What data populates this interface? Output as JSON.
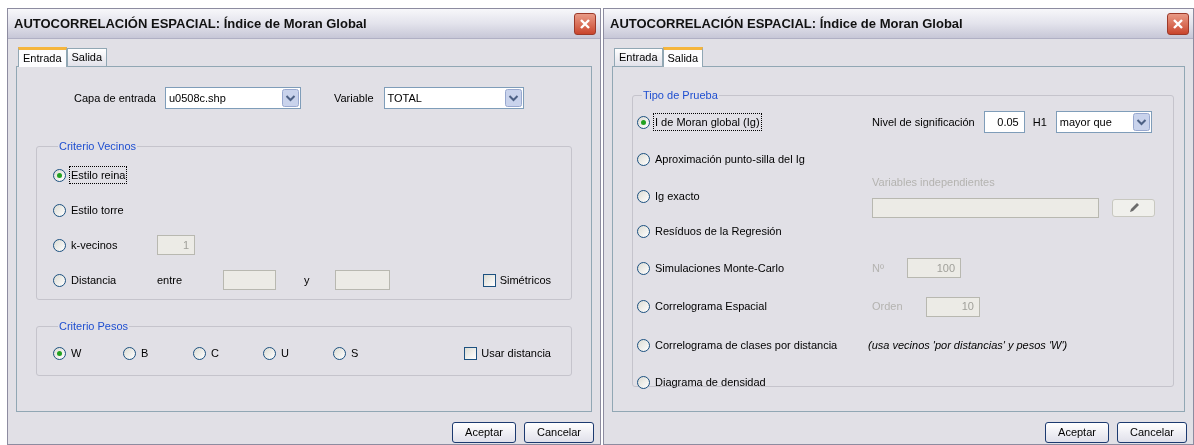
{
  "dialogs": [
    {
      "kind": "input",
      "title": "AUTOCORRELACIÓN ESPACIAL: Índice de Moran Global",
      "tabs": [
        {
          "label": "Entrada",
          "selected": true
        },
        {
          "label": "Salida",
          "selected": false
        }
      ],
      "fields": [
        {
          "label": "Capa de entrada",
          "value": "u0508c.shp"
        },
        {
          "label": "Variable",
          "value": "TOTAL"
        }
      ],
      "neighbors": {
        "title": "Criterio Vecinos",
        "options": [
          {
            "kind": "plain",
            "label": "Estilo reina",
            "selected": true,
            "focused": true
          },
          {
            "kind": "plain",
            "label": "Estilo torre",
            "selected": false,
            "focused": false
          },
          {
            "kind": "count",
            "label": "k-vecinos",
            "selected": false,
            "focused": false,
            "disabled": true,
            "value": "1"
          },
          {
            "kind": "range",
            "label": "Distancia",
            "selected": false,
            "focused": false,
            "disabled": true,
            "from_label": "entre",
            "to_label": "y",
            "checkbox": {
              "label": "Simétricos",
              "checked": false
            }
          }
        ]
      },
      "weights": {
        "title": "Criterio Pesos",
        "options": [
          {
            "label": "W",
            "selected": true
          },
          {
            "label": "B",
            "selected": false
          },
          {
            "label": "C",
            "selected": false
          },
          {
            "label": "U",
            "selected": false
          },
          {
            "label": "S",
            "selected": false
          }
        ],
        "checkbox": {
          "label": "Usar distancia",
          "checked": false
        }
      },
      "buttons": [
        "Aceptar",
        "Cancelar"
      ]
    },
    {
      "kind": "output",
      "title": "AUTOCORRELACIÓN ESPACIAL: Índice de Moran Global",
      "tabs": [
        {
          "label": "Entrada",
          "selected": false
        },
        {
          "label": "Salida",
          "selected": true
        }
      ],
      "test_type": {
        "title": "Tipo de Prueba",
        "options": [
          {
            "kind": "significance",
            "label": "I de Moran global (Ig)",
            "selected": true,
            "focused": true,
            "level_label": "Nivel de significación",
            "level_value": "0.05",
            "h1_label": "H1",
            "h1_value": "mayor que"
          },
          {
            "kind": "plain",
            "label": "Aproximación punto-silla del Ig",
            "selected": false,
            "focused": false
          },
          {
            "kind": "variables",
            "label": "Ig exacto",
            "selected": false,
            "focused": false,
            "disabled": true,
            "side_label": "Variables independientes"
          },
          {
            "kind": "plain",
            "label": "Resíduos de la Regresión",
            "selected": false,
            "focused": false
          },
          {
            "kind": "count",
            "label": "Simulaciones Monte-Carlo",
            "selected": false,
            "focused": false,
            "disabled": true,
            "side_label": "Nº",
            "value": "100"
          },
          {
            "kind": "count",
            "label": "Correlograma Espacial",
            "selected": false,
            "focused": false,
            "disabled": true,
            "side_label": "Orden",
            "value": "10"
          },
          {
            "kind": "note",
            "label": "Correlograma de clases por distancia",
            "selected": false,
            "focused": false,
            "note": "(usa vecinos 'por distancias' y pesos 'W')"
          },
          {
            "kind": "plain",
            "label": "Diagrama de densidad",
            "selected": false,
            "focused": false
          }
        ]
      },
      "buttons": [
        "Aceptar",
        "Cancelar"
      ]
    }
  ]
}
